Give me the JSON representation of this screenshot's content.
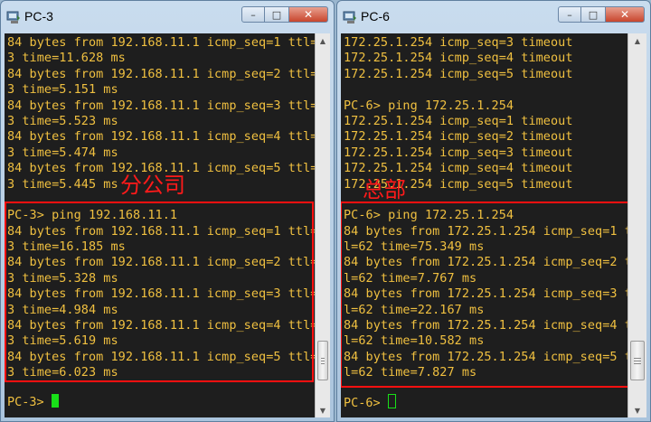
{
  "windows": [
    {
      "title": "PC-3",
      "controls": {
        "minimize": "–",
        "maximize": "□",
        "close": "✕"
      },
      "lines": [
        "84 bytes from 192.168.11.1 icmp_seq=1 ttl=6",
        "3 time=11.628 ms",
        "84 bytes from 192.168.11.1 icmp_seq=2 ttl=6",
        "3 time=5.151 ms",
        "84 bytes from 192.168.11.1 icmp_seq=3 ttl=6",
        "3 time=5.523 ms",
        "84 bytes from 192.168.11.1 icmp_seq=4 ttl=6",
        "3 time=5.474 ms",
        "84 bytes from 192.168.11.1 icmp_seq=5 ttl=6",
        "3 time=5.445 ms",
        "",
        "PC-3> ping 192.168.11.1",
        "84 bytes from 192.168.11.1 icmp_seq=1 ttl=6",
        "3 time=16.185 ms",
        "84 bytes from 192.168.11.1 icmp_seq=2 ttl=6",
        "3 time=5.328 ms",
        "84 bytes from 192.168.11.1 icmp_seq=3 ttl=6",
        "3 time=4.984 ms",
        "84 bytes from 192.168.11.1 icmp_seq=4 ttl=6",
        "3 time=5.619 ms",
        "84 bytes from 192.168.11.1 icmp_seq=5 ttl=6",
        "3 time=6.023 ms"
      ],
      "prompt": "PC-3> ",
      "annotation": "分公司"
    },
    {
      "title": "PC-6",
      "controls": {
        "minimize": "–",
        "maximize": "□",
        "close": "✕"
      },
      "lines": [
        "172.25.1.254 icmp_seq=3 timeout",
        "172.25.1.254 icmp_seq=4 timeout",
        "172.25.1.254 icmp_seq=5 timeout",
        "",
        "PC-6> ping 172.25.1.254",
        "172.25.1.254 icmp_seq=1 timeout",
        "172.25.1.254 icmp_seq=2 timeout",
        "172.25.1.254 icmp_seq=3 timeout",
        "172.25.1.254 icmp_seq=4 timeout",
        "172.25.1.254 icmp_seq=5 timeout",
        "",
        "PC-6> ping 172.25.1.254",
        "84 bytes from 172.25.1.254 icmp_seq=1 tt",
        "l=62 time=75.349 ms",
        "84 bytes from 172.25.1.254 icmp_seq=2 tt",
        "l=62 time=7.767 ms",
        "84 bytes from 172.25.1.254 icmp_seq=3 tt",
        "l=62 time=22.167 ms",
        "84 bytes from 172.25.1.254 icmp_seq=4 tt",
        "l=62 time=10.582 ms",
        "84 bytes from 172.25.1.254 icmp_seq=5 tt",
        "l=62 time=7.827 ms"
      ],
      "prompt": "PC-6> ",
      "annotation": "总部"
    }
  ],
  "colors": {
    "terminal_bg": "#1e1e1e",
    "terminal_text": "#f0c040",
    "cursor": "#18e018",
    "annotation": "#ff1a1a"
  }
}
